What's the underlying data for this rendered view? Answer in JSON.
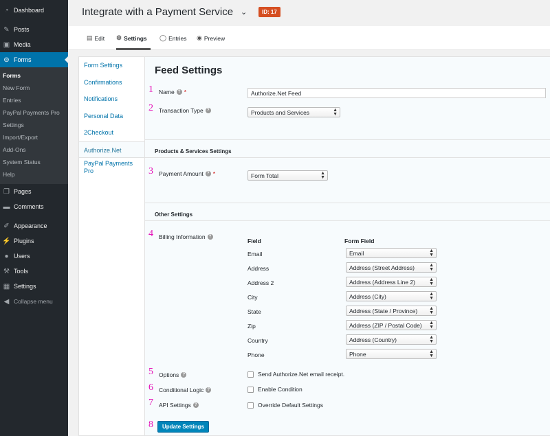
{
  "admin_menu": {
    "items": [
      {
        "label": "Dashboard",
        "icon": "dashboard-icon"
      },
      {
        "label": "Posts",
        "icon": "pin-icon"
      },
      {
        "label": "Media",
        "icon": "media-icon"
      },
      {
        "label": "Forms",
        "icon": "forms-icon"
      }
    ],
    "forms_sub": [
      "Forms",
      "New Form",
      "Entries",
      "PayPal Payments Pro",
      "Settings",
      "Import/Export",
      "Add-Ons",
      "System Status",
      "Help"
    ],
    "items_after": [
      {
        "label": "Pages",
        "icon": "pages-icon"
      },
      {
        "label": "Comments",
        "icon": "comments-icon"
      },
      {
        "label": "Appearance",
        "icon": "brush-icon"
      },
      {
        "label": "Plugins",
        "icon": "plug-icon"
      },
      {
        "label": "Users",
        "icon": "users-icon"
      },
      {
        "label": "Tools",
        "icon": "wrench-icon"
      },
      {
        "label": "Settings",
        "icon": "settings-icon"
      }
    ],
    "collapse_label": "Collapse menu"
  },
  "header": {
    "form_title": "Integrate with a Payment Service",
    "id_badge": "ID: 17"
  },
  "toolbar": {
    "edit": "Edit",
    "settings": "Settings",
    "entries": "Entries",
    "preview": "Preview"
  },
  "settings_nav": [
    "Form Settings",
    "Confirmations",
    "Notifications",
    "Personal Data",
    "2Checkout",
    "Authorize.Net",
    "PayPal Payments Pro"
  ],
  "feed": {
    "title": "Feed Settings",
    "name_label": "Name",
    "name_value": "Authorize.Net Feed",
    "transaction_type_label": "Transaction Type",
    "transaction_type_value": "Products and Services",
    "products_section": "Products & Services Settings",
    "payment_amount_label": "Payment Amount",
    "payment_amount_value": "Form Total",
    "other_section": "Other Settings",
    "billing_label": "Billing Information",
    "col_field": "Field",
    "col_form_field": "Form Field",
    "billing_rows": [
      {
        "field": "Email",
        "value": "Email"
      },
      {
        "field": "Address",
        "value": "Address (Street Address)"
      },
      {
        "field": "Address 2",
        "value": "Address (Address Line 2)"
      },
      {
        "field": "City",
        "value": "Address (City)"
      },
      {
        "field": "State",
        "value": "Address (State / Province)"
      },
      {
        "field": "Zip",
        "value": "Address (ZIP / Postal Code)"
      },
      {
        "field": "Country",
        "value": "Address (Country)"
      },
      {
        "field": "Phone",
        "value": "Phone"
      }
    ],
    "options_label": "Options",
    "options_checkbox": "Send Authorize.Net email receipt.",
    "conditional_label": "Conditional Logic",
    "conditional_checkbox": "Enable Condition",
    "api_label": "API Settings",
    "api_checkbox": "Override Default Settings",
    "update_button": "Update Settings",
    "required_mark": "*"
  },
  "markers": [
    "1",
    "2",
    "3",
    "4",
    "5",
    "6",
    "7",
    "8"
  ],
  "colors": {
    "admin_bg": "#23282d",
    "accent": "#0073aa",
    "marker": "#e514b8",
    "badge": "#d54e21",
    "button": "#0085ba"
  }
}
